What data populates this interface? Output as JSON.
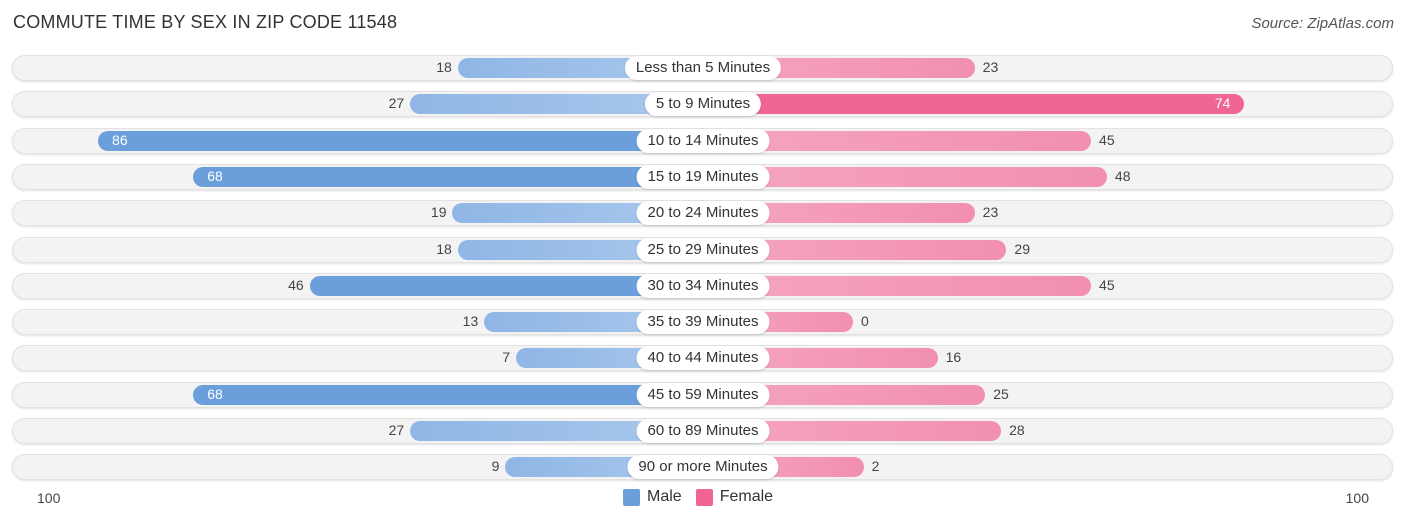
{
  "title": "COMMUTE TIME BY SEX IN ZIP CODE 11548",
  "source": "Source: ZipAtlas.com",
  "chart_data": {
    "type": "bar",
    "orientation": "horizontal-diverging",
    "title": "COMMUTE TIME BY SEX IN ZIP CODE 11548",
    "categories": [
      "Less than 5 Minutes",
      "5 to 9 Minutes",
      "10 to 14 Minutes",
      "15 to 19 Minutes",
      "20 to 24 Minutes",
      "25 to 29 Minutes",
      "30 to 34 Minutes",
      "35 to 39 Minutes",
      "40 to 44 Minutes",
      "45 to 59 Minutes",
      "60 to 89 Minutes",
      "90 or more Minutes"
    ],
    "series": [
      {
        "name": "Male",
        "color": "#6a9fdc",
        "values": [
          18,
          27,
          86,
          68,
          19,
          18,
          46,
          13,
          7,
          68,
          27,
          9
        ]
      },
      {
        "name": "Female",
        "color": "#f06591",
        "values": [
          23,
          74,
          45,
          48,
          23,
          29,
          45,
          0,
          16,
          25,
          28,
          2
        ]
      }
    ],
    "axis": {
      "left_label": "100",
      "right_label": "100",
      "range": [
        -100,
        100
      ]
    },
    "legend": {
      "position": "bottom-center",
      "items": [
        "Male",
        "Female"
      ]
    }
  }
}
